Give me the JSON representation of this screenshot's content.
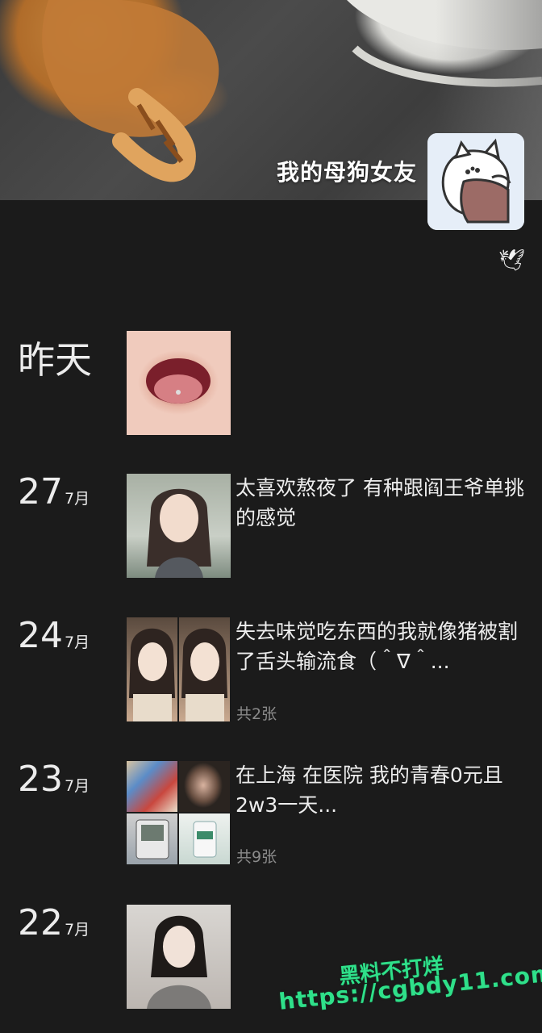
{
  "profile": {
    "username": "我的母狗女友"
  },
  "header_icon": "dove-icon",
  "posts": [
    {
      "date_label": "昨天",
      "text": "",
      "count": ""
    },
    {
      "day": "27",
      "month": "7月",
      "text": "太喜欢熬夜了 有种跟阎王爷单挑的感觉",
      "count": ""
    },
    {
      "day": "24",
      "month": "7月",
      "text": "失去味觉吃东西的我就像猪被割了舌头输流食（＾∇＾...",
      "count": "共2张"
    },
    {
      "day": "23",
      "month": "7月",
      "text": "在上海 在医院 我的青春0元且2w3一天...",
      "count": "共9张"
    },
    {
      "day": "22",
      "month": "7月",
      "text": "",
      "count": ""
    }
  ],
  "watermark": {
    "line1": "黑料不打烊",
    "line2": "https://cgbdy11.com"
  }
}
